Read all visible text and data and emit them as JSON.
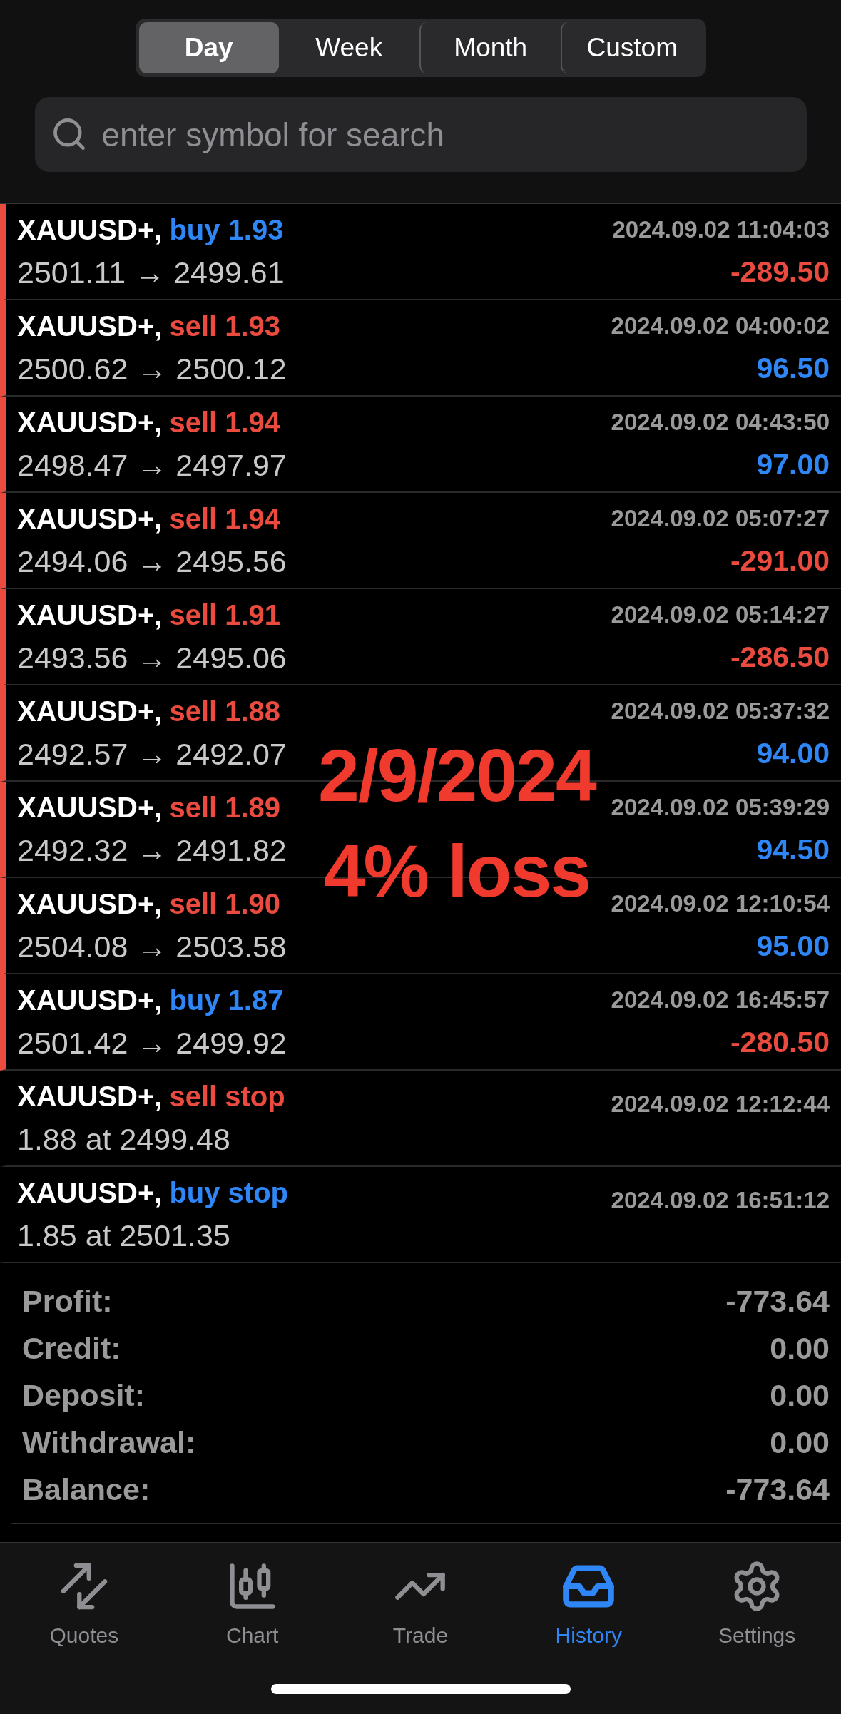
{
  "period_tabs": [
    {
      "label": "Day",
      "selected": true
    },
    {
      "label": "Week",
      "selected": false
    },
    {
      "label": "Month",
      "selected": false
    },
    {
      "label": "Custom",
      "selected": false
    }
  ],
  "search": {
    "placeholder": "enter symbol for search"
  },
  "rows": [
    {
      "kind": "deal",
      "symbol": "XAUUSD+,",
      "trade": {
        "text": "buy 1.93",
        "color": "#2f86f6"
      },
      "time": "2024.09.02 11:04:03",
      "prices": "2501.11 → 2499.61",
      "profit": {
        "text": "-289.50",
        "color": "#eb4a3f"
      }
    },
    {
      "kind": "deal",
      "symbol": "XAUUSD+,",
      "trade": {
        "text": "sell 1.93",
        "color": "#eb4a3f"
      },
      "time": "2024.09.02 04:00:02",
      "prices": "2500.62 → 2500.12",
      "profit": {
        "text": "96.50",
        "color": "#2f86f6"
      }
    },
    {
      "kind": "deal",
      "symbol": "XAUUSD+,",
      "trade": {
        "text": "sell 1.94",
        "color": "#eb4a3f"
      },
      "time": "2024.09.02 04:43:50",
      "prices": "2498.47 → 2497.97",
      "profit": {
        "text": "97.00",
        "color": "#2f86f6"
      }
    },
    {
      "kind": "deal",
      "symbol": "XAUUSD+,",
      "trade": {
        "text": "sell 1.94",
        "color": "#eb4a3f"
      },
      "time": "2024.09.02 05:07:27",
      "prices": "2494.06 → 2495.56",
      "profit": {
        "text": "-291.00",
        "color": "#eb4a3f"
      }
    },
    {
      "kind": "deal",
      "symbol": "XAUUSD+,",
      "trade": {
        "text": "sell 1.91",
        "color": "#eb4a3f"
      },
      "time": "2024.09.02 05:14:27",
      "prices": "2493.56 → 2495.06",
      "profit": {
        "text": "-286.50",
        "color": "#eb4a3f"
      }
    },
    {
      "kind": "deal",
      "symbol": "XAUUSD+,",
      "trade": {
        "text": "sell 1.88",
        "color": "#eb4a3f"
      },
      "time": "2024.09.02 05:37:32",
      "prices": "2492.57 → 2492.07",
      "profit": {
        "text": "94.00",
        "color": "#2f86f6"
      }
    },
    {
      "kind": "deal",
      "symbol": "XAUUSD+,",
      "trade": {
        "text": "sell 1.89",
        "color": "#eb4a3f"
      },
      "time": "2024.09.02 05:39:29",
      "prices": "2492.32 → 2491.82",
      "profit": {
        "text": "94.50",
        "color": "#2f86f6"
      }
    },
    {
      "kind": "deal",
      "symbol": "XAUUSD+,",
      "trade": {
        "text": "sell 1.90",
        "color": "#eb4a3f"
      },
      "time": "2024.09.02 12:10:54",
      "prices": "2504.08 → 2503.58",
      "profit": {
        "text": "95.00",
        "color": "#2f86f6"
      }
    },
    {
      "kind": "deal",
      "symbol": "XAUUSD+,",
      "trade": {
        "text": "buy 1.87",
        "color": "#2f86f6"
      },
      "time": "2024.09.02 16:45:57",
      "prices": "2501.42 → 2499.92",
      "profit": {
        "text": "-280.50",
        "color": "#eb4a3f"
      }
    },
    {
      "kind": "order",
      "symbol": "XAUUSD+,",
      "trade": {
        "text": "sell stop",
        "color": "#eb4a3f"
      },
      "time": "2024.09.02 12:12:44",
      "prices": "1.88 at 2499.48"
    },
    {
      "kind": "order",
      "symbol": "XAUUSD+,",
      "trade": {
        "text": "buy stop",
        "color": "#2f86f6"
      },
      "time": "2024.09.02 16:51:12",
      "prices": "1.85 at 2501.35"
    }
  ],
  "summary": [
    {
      "label": "Profit:",
      "value": "-773.64"
    },
    {
      "label": "Credit:",
      "value": "0.00"
    },
    {
      "label": "Deposit:",
      "value": "0.00"
    },
    {
      "label": "Withdrawal:",
      "value": "0.00"
    },
    {
      "label": "Balance:",
      "value": "-773.64"
    }
  ],
  "overlay": {
    "lines": [
      "2/9/2024",
      "4% loss"
    ]
  },
  "tab_bar": [
    {
      "label": "Quotes",
      "selected": false
    },
    {
      "label": "Chart",
      "selected": false
    },
    {
      "label": "Trade",
      "selected": false
    },
    {
      "label": "History",
      "selected": true
    },
    {
      "label": "Settings",
      "selected": false
    }
  ]
}
